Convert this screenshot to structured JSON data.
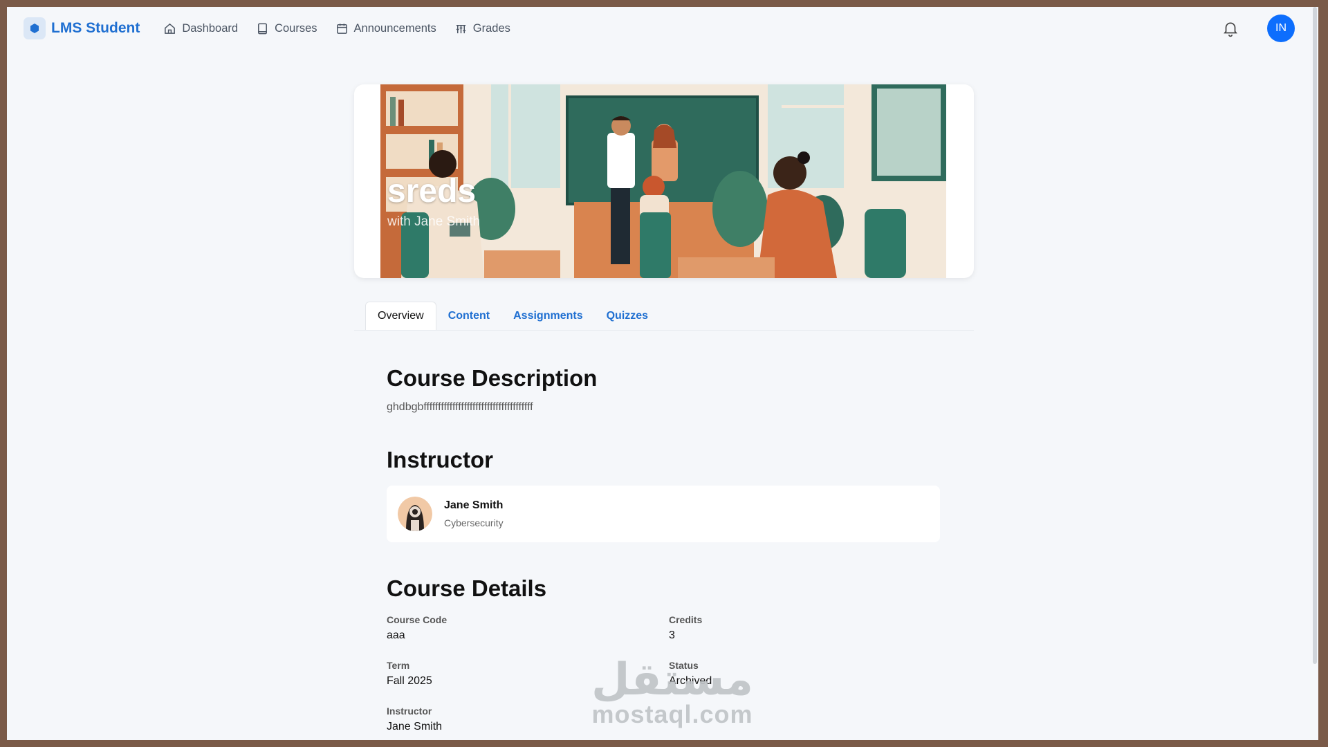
{
  "nav": {
    "brand": "LMS Student",
    "items": [
      {
        "label": "Dashboard",
        "icon": "home-icon"
      },
      {
        "label": "Courses",
        "icon": "book-icon"
      },
      {
        "label": "Announcements",
        "icon": "calendar-icon"
      },
      {
        "label": "Grades",
        "icon": "grades-icon"
      }
    ],
    "user_initials": "IN"
  },
  "hero": {
    "title": "sreds",
    "subtitle": "with Jane Smith"
  },
  "tabs": [
    {
      "label": "Overview",
      "active": true
    },
    {
      "label": "Content",
      "active": false
    },
    {
      "label": "Assignments",
      "active": false
    },
    {
      "label": "Quizzes",
      "active": false
    }
  ],
  "overview": {
    "description_heading": "Course Description",
    "description": "ghdbgbffffffffffffffffffffffffffffffffffffff",
    "instructor_heading": "Instructor",
    "instructor": {
      "name": "Jane Smith",
      "department": "Cybersecurity"
    },
    "details_heading": "Course Details",
    "details": [
      {
        "label": "Course Code",
        "value": "aaa"
      },
      {
        "label": "Credits",
        "value": "3"
      },
      {
        "label": "Term",
        "value": "Fall 2025"
      },
      {
        "label": "Status",
        "value": "Archived"
      },
      {
        "label": "Instructor",
        "value": "Jane Smith"
      }
    ]
  },
  "watermark": {
    "arabic": "مستقل",
    "latin": "mostaql.com"
  },
  "colors": {
    "accent": "#1f6fd1",
    "avatar": "#0d6efd",
    "background": "#f5f7fa"
  }
}
